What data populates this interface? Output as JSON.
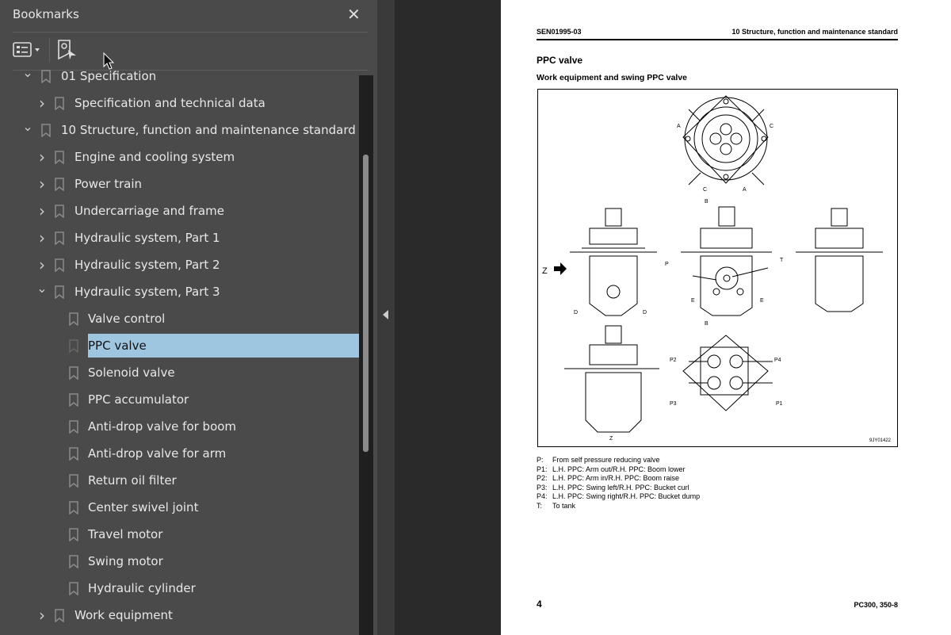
{
  "sidebar": {
    "title": "Bookmarks",
    "close_icon": "close-icon",
    "toolbar": {
      "options_icon": "list-options-icon",
      "find_icon": "find-current-bookmark-icon"
    },
    "items": [
      {
        "label": "01 Specification",
        "level": 0,
        "state": "expanded"
      },
      {
        "label": "Specification and technical data",
        "level": 1,
        "state": "collapsed"
      },
      {
        "label": "10 Structure, function and maintenance standard",
        "level": 0,
        "state": "expanded"
      },
      {
        "label": "Engine and cooling system",
        "level": 1,
        "state": "collapsed"
      },
      {
        "label": "Power train",
        "level": 1,
        "state": "collapsed"
      },
      {
        "label": "Undercarriage and frame",
        "level": 1,
        "state": "collapsed"
      },
      {
        "label": "Hydraulic system, Part 1",
        "level": 1,
        "state": "collapsed"
      },
      {
        "label": "Hydraulic system, Part 2",
        "level": 1,
        "state": "collapsed"
      },
      {
        "label": "Hydraulic system, Part 3",
        "level": 1,
        "state": "expanded"
      },
      {
        "label": "Valve control",
        "level": 2,
        "state": "leaf"
      },
      {
        "label": "PPC valve",
        "level": 2,
        "state": "leaf",
        "selected": true
      },
      {
        "label": "Solenoid valve",
        "level": 2,
        "state": "leaf"
      },
      {
        "label": "PPC accumulator",
        "level": 2,
        "state": "leaf"
      },
      {
        "label": "Anti-drop valve for boom",
        "level": 2,
        "state": "leaf"
      },
      {
        "label": "Anti-drop valve for arm",
        "level": 2,
        "state": "leaf"
      },
      {
        "label": "Return oil filter",
        "level": 2,
        "state": "leaf"
      },
      {
        "label": "Center swivel joint",
        "level": 2,
        "state": "leaf"
      },
      {
        "label": "Travel motor",
        "level": 2,
        "state": "leaf"
      },
      {
        "label": "Swing motor",
        "level": 2,
        "state": "leaf"
      },
      {
        "label": "Hydraulic cylinder",
        "level": 2,
        "state": "leaf"
      },
      {
        "label": "Work equipment",
        "level": 1,
        "state": "collapsed"
      }
    ],
    "selection_color": "#9fc6e0"
  },
  "page": {
    "header_left": "SEN01995-03",
    "header_right": "10 Structure, function and maintenance standard",
    "title": "PPC valve",
    "subtitle": "Work equipment and swing PPC valve",
    "figure": {
      "code": "9JY01422",
      "labels": {
        "a": "A",
        "b": "B",
        "c": "C",
        "d": "D",
        "e": "E",
        "z": "Z",
        "p": "P",
        "t": "T",
        "p1": "P1",
        "p2": "P2",
        "p3": "P3",
        "p4": "P4"
      }
    },
    "legend": [
      {
        "key": "P:",
        "text": "From self pressure reducing valve"
      },
      {
        "key": "P1:",
        "text": "L.H. PPC: Arm out/R.H. PPC: Boom lower"
      },
      {
        "key": "P2:",
        "text": "L.H. PPC: Arm in/R.H. PPC: Boom raise"
      },
      {
        "key": "P3:",
        "text": "L.H. PPC: Swing left/R.H. PPC: Bucket curl"
      },
      {
        "key": "P4:",
        "text": "L.H. PPC: Swing right/R.H. PPC: Bucket dump"
      },
      {
        "key": "T:",
        "text": "To tank"
      }
    ],
    "page_number": "4",
    "model": "PC300, 350-8"
  }
}
